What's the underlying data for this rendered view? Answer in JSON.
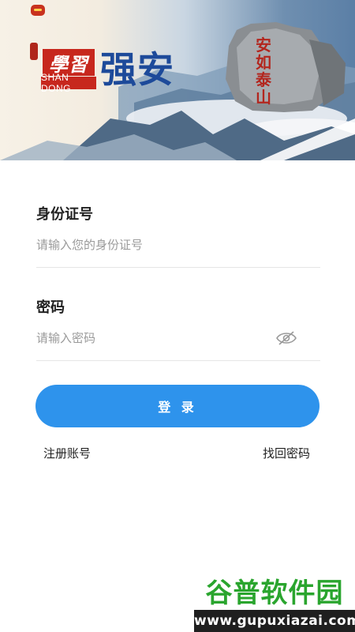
{
  "banner": {
    "logo_xuexi": "學習",
    "logo_region": "SHAN DONG",
    "logo_slogan": "强安",
    "rock_inscription": "安如泰山"
  },
  "form": {
    "id_label": "身份证号",
    "id_placeholder": "请输入您的身份证号",
    "password_label": "密码",
    "password_placeholder": "请输入密码",
    "password_visibility_icon": "eye-off-icon",
    "login_button": "登 录",
    "register_link": "注册账号",
    "forgot_link": "找回密码"
  },
  "colors": {
    "primary_button": "#2e93ec",
    "logo_red": "#c7271d",
    "logo_blue": "#1d4a9a"
  },
  "watermark": {
    "title": "谷普软件园",
    "url": "www.gupuxiazai.com"
  }
}
